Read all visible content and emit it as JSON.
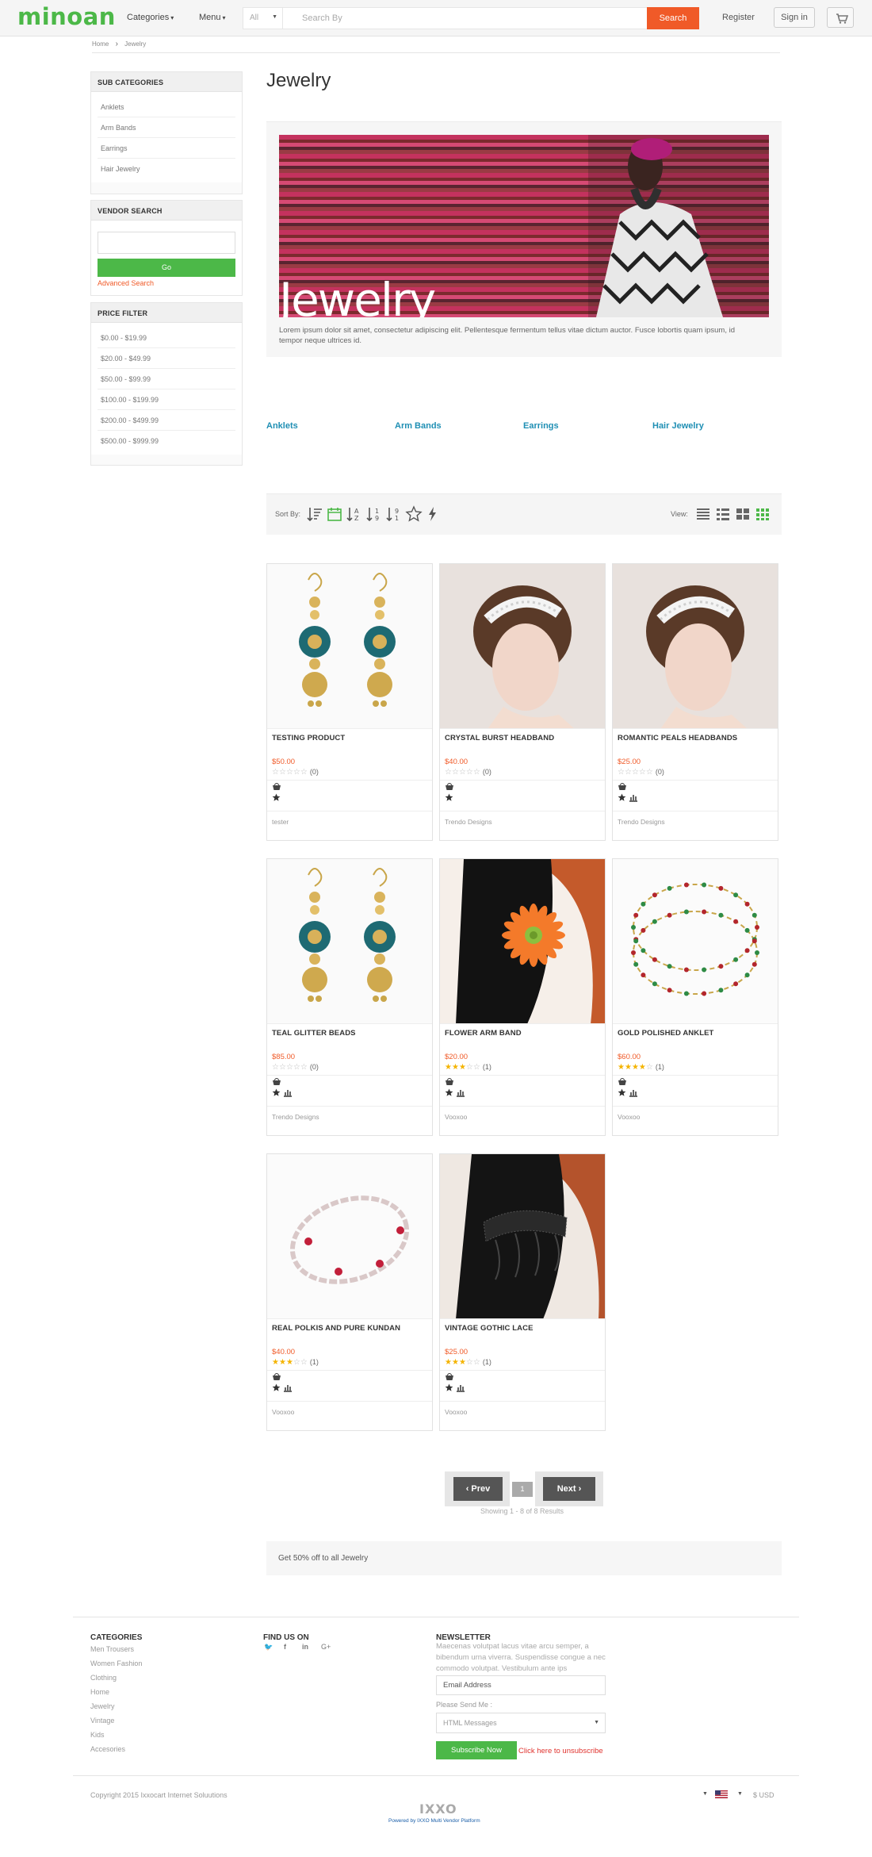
{
  "header": {
    "logo": "minoan",
    "categories_label": "Categories",
    "menu_label": "Menu",
    "search_category": "All",
    "search_placeholder": "Search By",
    "search_button": "Search",
    "register": "Register",
    "sign_in": "Sign in"
  },
  "breadcrumb": [
    "Home",
    "Jewelry"
  ],
  "sidebar": {
    "sub_categories": {
      "title": "SUB CATEGORIES",
      "items": [
        "Anklets",
        "Arm Bands",
        "Earrings",
        "Hair Jewelry"
      ]
    },
    "vendor_search": {
      "title": "VENDOR SEARCH",
      "go": "Go",
      "advanced": "Advanced Search"
    },
    "price_filter": {
      "title": "PRICE FILTER",
      "items": [
        "$0.00 - $19.99",
        "$20.00 - $49.99",
        "$50.00 - $99.99",
        "$100.00 - $199.99",
        "$200.00 - $499.99",
        "$500.00 - $999.99"
      ]
    }
  },
  "main": {
    "title": "Jewelry",
    "banner_text": "Jewelry",
    "banner_desc": "Lorem ipsum dolor sit amet, consectetur adipiscing elit. Pellentesque fermentum tellus vitae dictum auctor. Fusce lobortis quam ipsum, id tempor neque ultrices id.",
    "subcategory_links": [
      "Anklets",
      "Arm Bands",
      "Earrings",
      "Hair Jewelry"
    ],
    "sort_label": "Sort By:",
    "view_label": "View:"
  },
  "products": [
    {
      "name": "TESTING PRODUCT",
      "price": "$50.00",
      "rating": 0,
      "count": "(0)",
      "vendor": "tester",
      "image": "earrings"
    },
    {
      "name": "CRYSTAL BURST HEADBAND",
      "price": "$40.00",
      "rating": 0,
      "count": "(0)",
      "vendor": "Trendo Designs",
      "image": "headband-woman"
    },
    {
      "name": "ROMANTIC PEALS HEADBANDS",
      "price": "$25.00",
      "rating": 0,
      "count": "(0)",
      "vendor": "Trendo Designs",
      "image": "headband-woman"
    },
    {
      "name": "TEAL GLITTER BEADS",
      "price": "$85.00",
      "rating": 0,
      "count": "(0)",
      "vendor": "Trendo Designs",
      "image": "earrings"
    },
    {
      "name": "FLOWER ARM BAND",
      "price": "$20.00",
      "rating": 3,
      "count": "(1)",
      "vendor": "Vooxoo",
      "image": "flower-armband"
    },
    {
      "name": "GOLD POLISHED ANKLET",
      "price": "$60.00",
      "rating": 4,
      "count": "(1)",
      "vendor": "Vooxoo",
      "image": "anklet"
    },
    {
      "name": "REAL POLKIS AND PURE KUNDAN",
      "price": "$40.00",
      "rating": 3,
      "count": "(1)",
      "vendor": "Vooxoo",
      "image": "bracelet"
    },
    {
      "name": "VINTAGE GOTHIC LACE",
      "price": "$25.00",
      "rating": 3,
      "count": "(1)",
      "vendor": "Vooxoo",
      "image": "lace-armband"
    }
  ],
  "pagination": {
    "prev": "‹ Prev",
    "page": "1",
    "next": "Next ›",
    "showing": "Showing 1 - 8 of 8 Results"
  },
  "promo": "Get 50% off to all Jewelry",
  "footer": {
    "categories_title": "CATEGORIES",
    "categories": [
      "Men Trousers",
      "Women Fashion",
      "Clothing",
      "Home",
      "Jewelry",
      "Vintage",
      "Kids",
      "Accesories"
    ],
    "find_us_title": "FIND US ON",
    "social": [
      "twitter-icon",
      "facebook-icon",
      "linkedin-icon",
      "google-plus-icon"
    ],
    "newsletter_title": "NEWSLETTER",
    "newsletter_text": "Maecenas volutpat lacus vitae arcu semper, a bibendum urna viverra. Suspendisse congue a nec commodo volutpat. Vestibulum ante ips",
    "email_placeholder": "Email Address",
    "send_label": "Please Send Me :",
    "send_option": "HTML Messages",
    "subscribe": "Subscribe Now",
    "unsubscribe": "Click here to unsubscribe",
    "copyright": "Copyright 2015 Ixxocart Internet Soluutions",
    "bottom_logo": "IXXO",
    "powered": "Powered by IXXO Multi Vendor Platform",
    "currency": "$ USD"
  },
  "colors": {
    "brand_green": "#4cb848",
    "accent_orange": "#f05a28",
    "link_blue": "#1f8fb4",
    "star": "#f4b400"
  }
}
